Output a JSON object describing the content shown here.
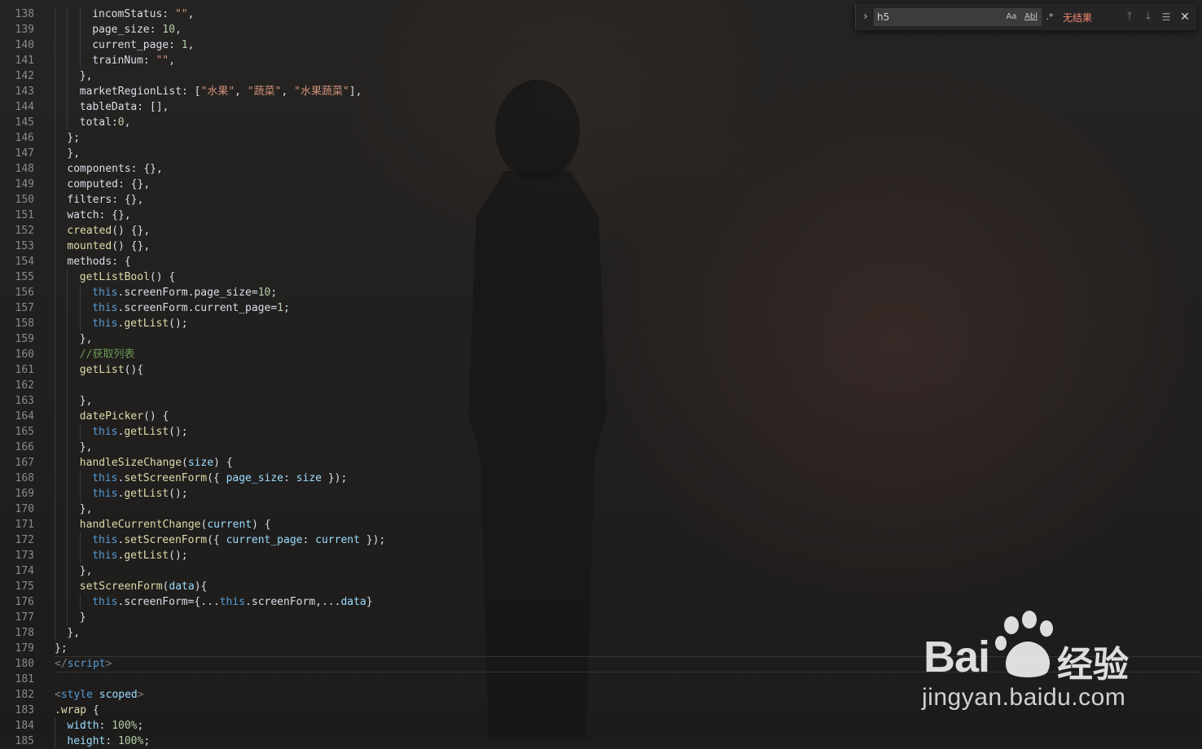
{
  "editor": {
    "lines": [
      {
        "num": "138",
        "indent": 3,
        "tokens": [
          [
            "incomStatus",
            "p"
          ],
          [
            ": ",
            "p"
          ],
          [
            "\"\"",
            "s"
          ],
          [
            ",",
            "p"
          ]
        ]
      },
      {
        "num": "139",
        "indent": 3,
        "tokens": [
          [
            "page_size",
            "p"
          ],
          [
            ": ",
            "p"
          ],
          [
            "10",
            "n"
          ],
          [
            ",",
            "p"
          ]
        ]
      },
      {
        "num": "140",
        "indent": 3,
        "tokens": [
          [
            "current_page",
            "p"
          ],
          [
            ": ",
            "p"
          ],
          [
            "1",
            "n"
          ],
          [
            ",",
            "p"
          ]
        ]
      },
      {
        "num": "141",
        "indent": 3,
        "tokens": [
          [
            "trainNum",
            "p"
          ],
          [
            ": ",
            "p"
          ],
          [
            "\"\"",
            "s"
          ],
          [
            ",",
            "p"
          ]
        ]
      },
      {
        "num": "142",
        "indent": 2,
        "tokens": [
          [
            "},",
            "p"
          ]
        ]
      },
      {
        "num": "143",
        "indent": 2,
        "tokens": [
          [
            "marketRegionList",
            "p"
          ],
          [
            ": [",
            "p"
          ],
          [
            "\"水果\"",
            "s"
          ],
          [
            ", ",
            "p"
          ],
          [
            "\"蔬菜\"",
            "s"
          ],
          [
            ", ",
            "p"
          ],
          [
            "\"水果蔬菜\"",
            "s"
          ],
          [
            "],",
            "p"
          ]
        ]
      },
      {
        "num": "144",
        "indent": 2,
        "tokens": [
          [
            "tableData",
            "p"
          ],
          [
            ": [],",
            "p"
          ]
        ]
      },
      {
        "num": "145",
        "indent": 2,
        "tokens": [
          [
            "total",
            "p"
          ],
          [
            ":",
            "p"
          ],
          [
            "0",
            "n"
          ],
          [
            ",",
            "p"
          ]
        ]
      },
      {
        "num": "146",
        "indent": 1,
        "tokens": [
          [
            "};",
            "p"
          ]
        ]
      },
      {
        "num": "147",
        "indent": 1,
        "tokens": [
          [
            "},",
            "p"
          ]
        ],
        "shift": -15
      },
      {
        "num": "148",
        "indent": 1,
        "tokens": [
          [
            "components",
            "p"
          ],
          [
            ": {},",
            "p"
          ]
        ]
      },
      {
        "num": "149",
        "indent": 1,
        "tokens": [
          [
            "computed",
            "p"
          ],
          [
            ": {},",
            "p"
          ]
        ]
      },
      {
        "num": "150",
        "indent": 1,
        "tokens": [
          [
            "filters",
            "p"
          ],
          [
            ": {},",
            "p"
          ]
        ]
      },
      {
        "num": "151",
        "indent": 1,
        "tokens": [
          [
            "watch",
            "p"
          ],
          [
            ": {},",
            "p"
          ]
        ]
      },
      {
        "num": "152",
        "indent": 1,
        "tokens": [
          [
            "created",
            "f"
          ],
          [
            "() {},",
            "p"
          ]
        ]
      },
      {
        "num": "153",
        "indent": 1,
        "tokens": [
          [
            "mounted",
            "f"
          ],
          [
            "() {},",
            "p"
          ]
        ]
      },
      {
        "num": "154",
        "indent": 1,
        "tokens": [
          [
            "methods",
            "p"
          ],
          [
            ": {",
            "p"
          ]
        ]
      },
      {
        "num": "155",
        "indent": 2,
        "tokens": [
          [
            "getListBool",
            "f"
          ],
          [
            "() {",
            "p"
          ]
        ]
      },
      {
        "num": "156",
        "indent": 3,
        "tokens": [
          [
            "this",
            "t"
          ],
          [
            ".screenForm.page_size=",
            "p"
          ],
          [
            "10",
            "n"
          ],
          [
            ";",
            "p"
          ]
        ]
      },
      {
        "num": "157",
        "indent": 3,
        "tokens": [
          [
            "this",
            "t"
          ],
          [
            ".screenForm.current_page=",
            "p"
          ],
          [
            "1",
            "n"
          ],
          [
            ";",
            "p"
          ]
        ]
      },
      {
        "num": "158",
        "indent": 3,
        "tokens": [
          [
            "this",
            "t"
          ],
          [
            ".",
            "p"
          ],
          [
            "getList",
            "f"
          ],
          [
            "();",
            "p"
          ]
        ]
      },
      {
        "num": "159",
        "indent": 2,
        "tokens": [
          [
            "},",
            "p"
          ]
        ]
      },
      {
        "num": "160",
        "indent": 2,
        "tokens": [
          [
            "//获取列表",
            "c"
          ]
        ]
      },
      {
        "num": "161",
        "indent": 2,
        "tokens": [
          [
            "getList",
            "f"
          ],
          [
            "(){",
            "p"
          ]
        ]
      },
      {
        "num": "162",
        "indent": 2,
        "tokens": []
      },
      {
        "num": "163",
        "indent": 2,
        "tokens": [
          [
            "},",
            "p"
          ]
        ]
      },
      {
        "num": "164",
        "indent": 2,
        "tokens": [
          [
            "datePicker",
            "f"
          ],
          [
            "() {",
            "p"
          ]
        ]
      },
      {
        "num": "165",
        "indent": 3,
        "tokens": [
          [
            "this",
            "t"
          ],
          [
            ".",
            "p"
          ],
          [
            "getList",
            "f"
          ],
          [
            "();",
            "p"
          ]
        ]
      },
      {
        "num": "166",
        "indent": 2,
        "tokens": [
          [
            "},",
            "p"
          ]
        ]
      },
      {
        "num": "167",
        "indent": 2,
        "tokens": [
          [
            "handleSizeChange",
            "f"
          ],
          [
            "(",
            "p"
          ],
          [
            "size",
            "k"
          ],
          [
            ") {",
            "p"
          ]
        ]
      },
      {
        "num": "168",
        "indent": 3,
        "tokens": [
          [
            "this",
            "t"
          ],
          [
            ".",
            "p"
          ],
          [
            "setScreenForm",
            "f"
          ],
          [
            "({ ",
            "p"
          ],
          [
            "page_size",
            "k"
          ],
          [
            ": ",
            "p"
          ],
          [
            "size",
            "k"
          ],
          [
            " });",
            "p"
          ]
        ]
      },
      {
        "num": "169",
        "indent": 3,
        "tokens": [
          [
            "this",
            "t"
          ],
          [
            ".",
            "p"
          ],
          [
            "getList",
            "f"
          ],
          [
            "();",
            "p"
          ]
        ]
      },
      {
        "num": "170",
        "indent": 2,
        "tokens": [
          [
            "},",
            "p"
          ]
        ]
      },
      {
        "num": "171",
        "indent": 2,
        "tokens": [
          [
            "handleCurrentChange",
            "f"
          ],
          [
            "(",
            "p"
          ],
          [
            "current",
            "k"
          ],
          [
            ") {",
            "p"
          ]
        ]
      },
      {
        "num": "172",
        "indent": 3,
        "tokens": [
          [
            "this",
            "t"
          ],
          [
            ".",
            "p"
          ],
          [
            "setScreenForm",
            "f"
          ],
          [
            "({ ",
            "p"
          ],
          [
            "current_page",
            "k"
          ],
          [
            ": ",
            "p"
          ],
          [
            "current",
            "k"
          ],
          [
            " });",
            "p"
          ]
        ]
      },
      {
        "num": "173",
        "indent": 3,
        "tokens": [
          [
            "this",
            "t"
          ],
          [
            ".",
            "p"
          ],
          [
            "getList",
            "f"
          ],
          [
            "();",
            "p"
          ]
        ]
      },
      {
        "num": "174",
        "indent": 2,
        "tokens": [
          [
            "},",
            "p"
          ]
        ]
      },
      {
        "num": "175",
        "indent": 2,
        "tokens": [
          [
            "setScreenForm",
            "f"
          ],
          [
            "(",
            "p"
          ],
          [
            "data",
            "k"
          ],
          [
            "){",
            "p"
          ]
        ]
      },
      {
        "num": "176",
        "indent": 3,
        "tokens": [
          [
            "this",
            "t"
          ],
          [
            ".screenForm={...",
            "p"
          ],
          [
            "this",
            "t"
          ],
          [
            ".screenForm,...",
            "p"
          ],
          [
            "data",
            "k"
          ],
          [
            "}",
            "p"
          ]
        ]
      },
      {
        "num": "177",
        "indent": 2,
        "tokens": [
          [
            "}",
            "p"
          ]
        ]
      },
      {
        "num": "178",
        "indent": 1,
        "tokens": [
          [
            "},",
            "p"
          ]
        ]
      },
      {
        "num": "179",
        "indent": 0,
        "tokens": [
          [
            "};",
            "p"
          ]
        ]
      },
      {
        "num": "180",
        "indent": 0,
        "tokens": [
          [
            "</",
            "g"
          ],
          [
            "script",
            "t"
          ],
          [
            ">",
            "g"
          ]
        ]
      },
      {
        "num": "181",
        "indent": 0,
        "tokens": []
      },
      {
        "num": "182",
        "indent": 0,
        "tokens": [
          [
            "<",
            "g"
          ],
          [
            "style",
            "t"
          ],
          [
            " ",
            "p"
          ],
          [
            "scoped",
            "k"
          ],
          [
            ">",
            "g"
          ]
        ]
      },
      {
        "num": "183",
        "indent": 0,
        "tokens": [
          [
            ".wrap",
            "f"
          ],
          [
            " {",
            "p"
          ]
        ]
      },
      {
        "num": "184",
        "indent": 1,
        "tokens": [
          [
            "width",
            "k"
          ],
          [
            ": ",
            "p"
          ],
          [
            "100%",
            "n"
          ],
          [
            ";",
            "p"
          ]
        ]
      },
      {
        "num": "185",
        "indent": 1,
        "tokens": [
          [
            "height",
            "k"
          ],
          [
            ": ",
            "p"
          ],
          [
            "100%",
            "n"
          ],
          [
            ";",
            "p"
          ]
        ]
      }
    ]
  },
  "find": {
    "query": "h5",
    "match_case_label": "Aa",
    "whole_word_label": "Abl",
    "regex_label": ".*",
    "status": "无结果",
    "prev_icon": "↑",
    "next_icon": "↓",
    "selection_icon": "☰",
    "close_icon": "✕",
    "toggle_icon": "›"
  },
  "watermark": {
    "brand": "Bai",
    "brand_cn": "经验",
    "url": "jingyan.baidu.com"
  },
  "colors": {
    "property": "#d8dee9",
    "string": "#ce9178",
    "number": "#b5cea8",
    "function": "#dcdcaa",
    "keyword": "#569cd6",
    "comment": "#6a9955",
    "error": "#f48771"
  }
}
